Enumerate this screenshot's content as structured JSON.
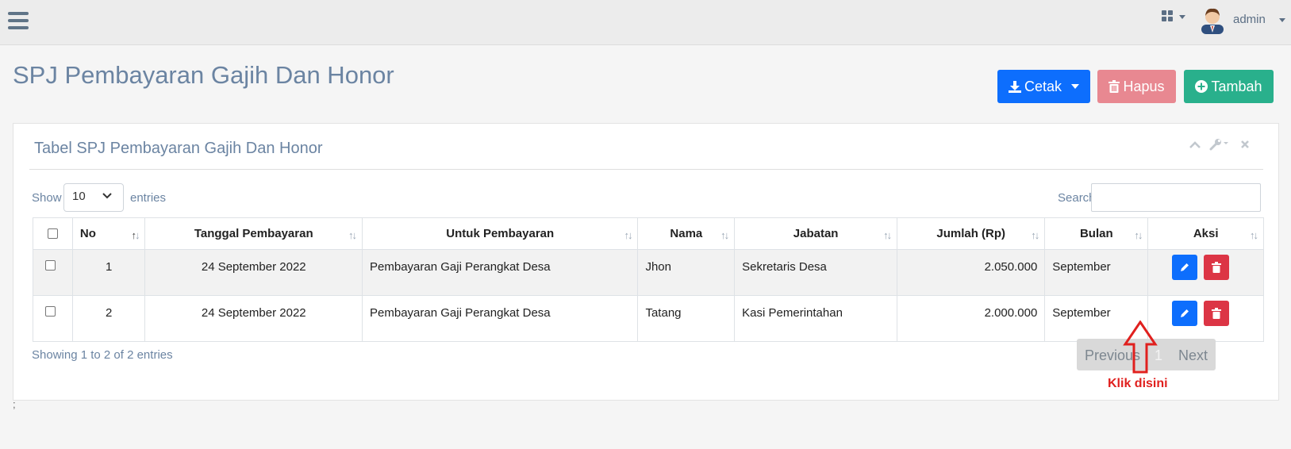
{
  "topbar": {
    "user": "admin",
    "icons": [
      "menu-icon",
      "grid-icon",
      "user-avatar-icon"
    ]
  },
  "page": {
    "title": "SPJ Pembayaran Gajih Dan Honor"
  },
  "actions": {
    "cetak_label": "Cetak",
    "hapus_label": "Hapus",
    "tambah_label": "Tambah"
  },
  "panel": {
    "title": "Tabel SPJ Pembayaran Gajih Dan Honor"
  },
  "table_controls": {
    "show_label": "Show",
    "length_value": "10",
    "entries_label": "entries",
    "search_label": "Search:",
    "search_value": ""
  },
  "table": {
    "headers": [
      "No",
      "Tanggal Pembayaran",
      "Untuk Pembayaran",
      "Nama",
      "Jabatan",
      "Jumlah (Rp)",
      "Bulan",
      "Aksi"
    ],
    "rows": [
      {
        "no": "1",
        "tanggal": "24 September 2022",
        "untuk": "Pembayaran Gaji Perangkat Desa",
        "nama": "Jhon",
        "jabatan": "Sekretaris Desa",
        "jumlah": "2.050.000",
        "bulan": "September"
      },
      {
        "no": "2",
        "tanggal": "24 September 2022",
        "untuk": "Pembayaran Gaji Perangkat Desa",
        "nama": "Tatang",
        "jabatan": "Kasi Pemerintahan",
        "jumlah": "2.000.000",
        "bulan": "September"
      }
    ]
  },
  "footer": {
    "info": "Showing 1 to 2 of 2 entries",
    "previous": "Previous",
    "page": "1",
    "next": "Next"
  },
  "annotation": {
    "text": "Klik disini",
    "color": "#e0201e"
  },
  "misc": {
    "semicolon": ";"
  },
  "colors": {
    "primary": "#0d6efd",
    "danger": "#dc3545",
    "hapus": "#e88891",
    "success": "#29b08c",
    "title": "#6b84a2"
  }
}
